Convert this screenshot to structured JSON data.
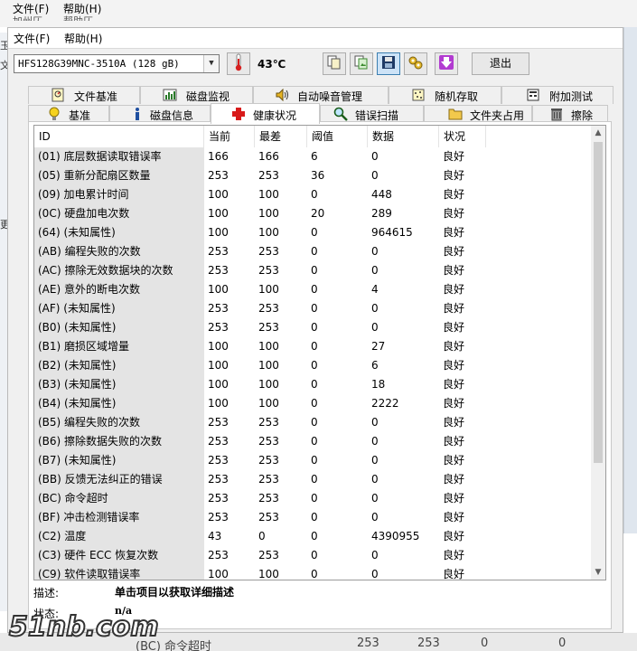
{
  "ghost": {
    "menu_file": "文件(F)",
    "menu_help": "帮助(H)",
    "row2_a": "加州仄",
    "row2_b": "帮助仄",
    "side_chars": [
      "玉",
      "文",
      "更"
    ],
    "below_id": "(BC) 命令超时",
    "below_v1": "253",
    "below_v2": "253",
    "below_v3": "0",
    "below_v4": "0"
  },
  "menu": {
    "file": "文件(F)",
    "help": "帮助(H)"
  },
  "toolbar": {
    "drive": "HFS128G39MNC-3510A (128 gB)",
    "temperature": "43℃",
    "exit_label": "退出"
  },
  "tabs_top": [
    "文件基准",
    "磁盘监视",
    "自动噪音管理",
    "随机存取",
    "附加测试"
  ],
  "tabs_bottom": [
    "基准",
    "磁盘信息",
    "健康状况",
    "错误扫描",
    "文件夹占用",
    "擦除"
  ],
  "table": {
    "headers": [
      "ID",
      "当前",
      "最差",
      "阈值",
      "数据",
      "状况"
    ],
    "rows": [
      [
        "(01) 底层数据读取错误率",
        "166",
        "166",
        "6",
        "0",
        "良好"
      ],
      [
        "(05) 重新分配扇区数量",
        "253",
        "253",
        "36",
        "0",
        "良好"
      ],
      [
        "(09) 加电累计时间",
        "100",
        "100",
        "0",
        "448",
        "良好"
      ],
      [
        "(0C) 硬盘加电次数",
        "100",
        "100",
        "20",
        "289",
        "良好"
      ],
      [
        "(64) (未知属性)",
        "100",
        "100",
        "0",
        "964615",
        "良好"
      ],
      [
        "(AB) 编程失败的次数",
        "253",
        "253",
        "0",
        "0",
        "良好"
      ],
      [
        "(AC) 擦除无效数据块的次数",
        "253",
        "253",
        "0",
        "0",
        "良好"
      ],
      [
        "(AE) 意外的断电次数",
        "100",
        "100",
        "0",
        "4",
        "良好"
      ],
      [
        "(AF) (未知属性)",
        "253",
        "253",
        "0",
        "0",
        "良好"
      ],
      [
        "(B0) (未知属性)",
        "253",
        "253",
        "0",
        "0",
        "良好"
      ],
      [
        "(B1) 磨损区域增量",
        "100",
        "100",
        "0",
        "27",
        "良好"
      ],
      [
        "(B2) (未知属性)",
        "100",
        "100",
        "0",
        "6",
        "良好"
      ],
      [
        "(B3) (未知属性)",
        "100",
        "100",
        "0",
        "18",
        "良好"
      ],
      [
        "(B4) (未知属性)",
        "100",
        "100",
        "0",
        "2222",
        "良好"
      ],
      [
        "(B5) 编程失败的次数",
        "253",
        "253",
        "0",
        "0",
        "良好"
      ],
      [
        "(B6) 擦除数据失败的次数",
        "253",
        "253",
        "0",
        "0",
        "良好"
      ],
      [
        "(B7) (未知属性)",
        "253",
        "253",
        "0",
        "0",
        "良好"
      ],
      [
        "(BB) 反馈无法纠正的错误",
        "253",
        "253",
        "0",
        "0",
        "良好"
      ],
      [
        "(BC) 命令超时",
        "253",
        "253",
        "0",
        "0",
        "良好"
      ],
      [
        "(BF) 冲击检测错误率",
        "253",
        "253",
        "0",
        "0",
        "良好"
      ],
      [
        "(C2) 温度",
        "43",
        "0",
        "0",
        "4390955",
        "良好"
      ],
      [
        "(C3) 硬件 ECC 恢复次数",
        "253",
        "253",
        "0",
        "0",
        "良好"
      ],
      [
        "(C9) 软件读取错误率",
        "100",
        "100",
        "0",
        "0",
        "良好"
      ]
    ]
  },
  "footer": {
    "desc_label": "描述:",
    "desc_value": "单击项目以获取详细描述",
    "status_label": "状态:",
    "status_value": "n/a"
  },
  "watermark": "51nb.com",
  "colors": {
    "accent": "#3c7fb1",
    "selected_tab": "#ffffff",
    "id_column": "#e4e4e4"
  }
}
